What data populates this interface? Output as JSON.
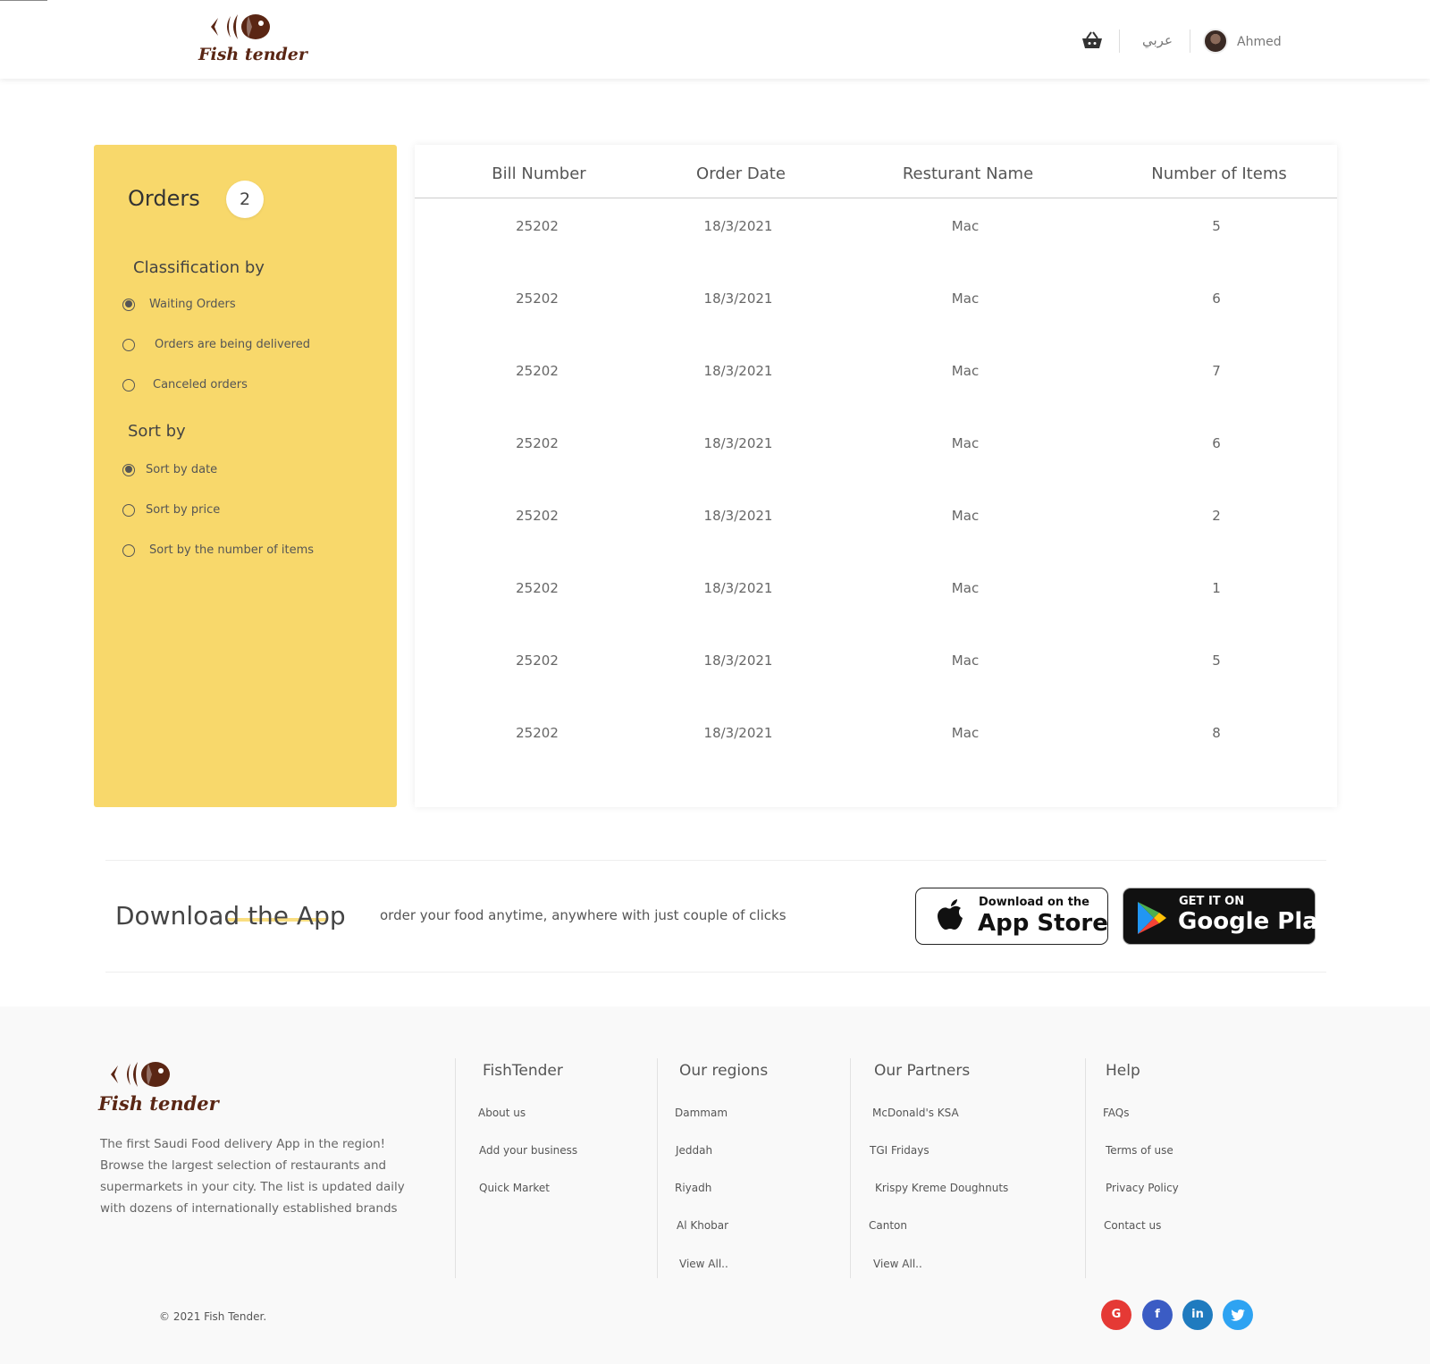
{
  "header": {
    "logo_text": "Fish tender",
    "lang": "عربي",
    "user_name": "Ahmed"
  },
  "sidebar": {
    "title": "Orders",
    "count": "2",
    "classification_heading": "Classification by",
    "classification": [
      {
        "label": "Waiting Orders",
        "checked": true
      },
      {
        "label": "Orders are being delivered",
        "checked": false
      },
      {
        "label": "Canceled orders",
        "checked": false
      }
    ],
    "sort_heading": "Sort by",
    "sort": [
      {
        "label": "Sort by date",
        "checked": true
      },
      {
        "label": "Sort by price",
        "checked": false
      },
      {
        "label": "Sort by the number of items",
        "checked": false
      }
    ]
  },
  "table": {
    "columns": [
      "Bill Number",
      "Order Date",
      "Resturant Name",
      "Number of Items"
    ],
    "rows": [
      [
        "25202",
        "18/3/2021",
        "Mac",
        "5"
      ],
      [
        "25202",
        "18/3/2021",
        "Mac",
        "6"
      ],
      [
        "25202",
        "18/3/2021",
        "Mac",
        "7"
      ],
      [
        "25202",
        "18/3/2021",
        "Mac",
        "6"
      ],
      [
        "25202",
        "18/3/2021",
        "Mac",
        "2"
      ],
      [
        "25202",
        "18/3/2021",
        "Mac",
        "1"
      ],
      [
        "25202",
        "18/3/2021",
        "Mac",
        "5"
      ],
      [
        "25202",
        "18/3/2021",
        "Mac",
        "8"
      ]
    ]
  },
  "download": {
    "title": "Download the App",
    "text": "order your food anytime, anywhere with just couple of clicks",
    "appstore_small": "Download on the",
    "appstore_big": "App Store",
    "googleplay_small": "GET IT ON",
    "googleplay_big": "Google Play"
  },
  "footer": {
    "logo_text": "Fish tender",
    "description": "The first Saudi Food delivery App in the region! Browse the largest selection of restaurants and supermarkets in your city. The list is updated daily with dozens of internationally established brands",
    "columns": [
      {
        "heading": "FishTender",
        "links": [
          "About us",
          "Add your business",
          "Quick Market"
        ]
      },
      {
        "heading": "Our regions",
        "links": [
          "Dammam",
          "Jeddah",
          "Riyadh",
          "Al Khobar",
          "View All.."
        ]
      },
      {
        "heading": "Our Partners",
        "links": [
          "McDonald's KSA",
          "TGI Fridays",
          "Krispy Kreme Doughnuts",
          "Canton",
          "View All.."
        ]
      },
      {
        "heading": "Help",
        "links": [
          "FAQs",
          "Terms of use",
          "Privacy Policy",
          "Contact us"
        ]
      }
    ],
    "copyright": "© 2021 Fish Tender.",
    "social": [
      {
        "icon": "google-icon",
        "color": "#e53935"
      },
      {
        "icon": "facebook-icon",
        "color": "#3b5cc4"
      },
      {
        "icon": "linkedin-icon",
        "color": "#1f7bbf"
      },
      {
        "icon": "twitter-icon",
        "color": "#2ea3f2"
      }
    ]
  },
  "colors": {
    "accent_yellow": "#f8d86b",
    "brand_brown": "#5a2614"
  }
}
